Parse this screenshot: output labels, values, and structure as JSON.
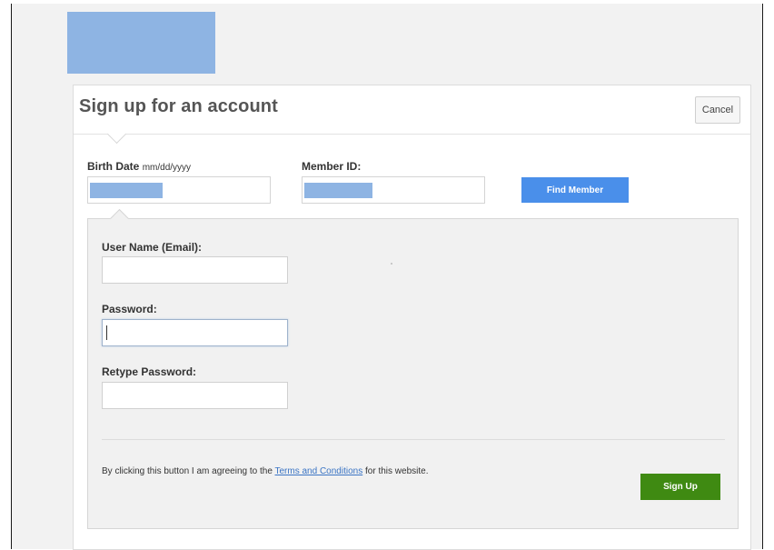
{
  "form": {
    "title": "Sign up for an account",
    "cancel_label": "Cancel",
    "birth_date_label": "Birth Date",
    "birth_date_hint": "mm/dd/yyyy",
    "member_id_label": "Member ID:",
    "find_member_label": "Find Member",
    "username_label": "User Name (Email):",
    "password_label": "Password:",
    "retype_password_label": "Retype Password:",
    "agree_prefix": "By clicking this button I am agreeing to the",
    "terms_link": "Terms and Conditions",
    "agree_suffix": "for this website.",
    "signup_label": "Sign Up"
  },
  "colors": {
    "redaction": "#8eb4e3",
    "primary_button": "#4a8fea",
    "signup_button": "#3f8a12",
    "link": "#3a74c4"
  }
}
